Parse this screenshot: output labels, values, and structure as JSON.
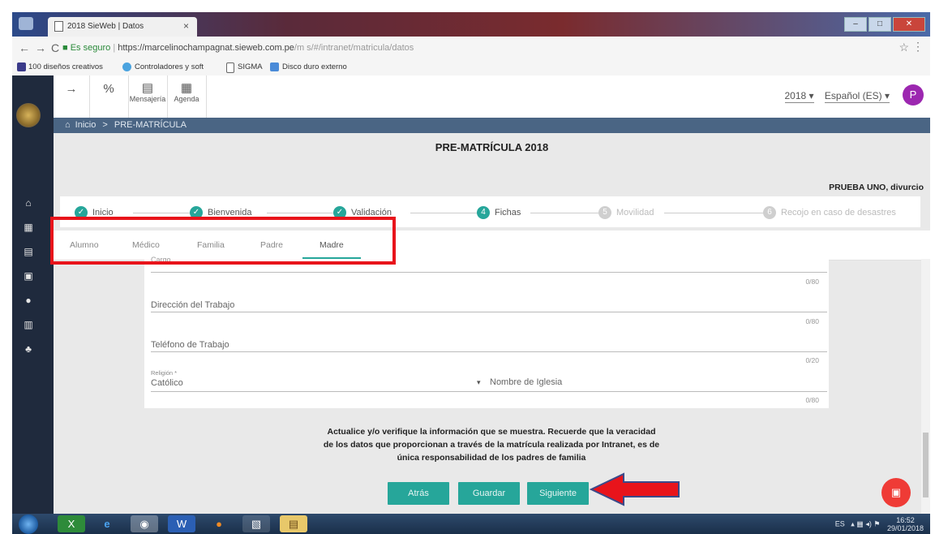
{
  "browser": {
    "tab_title": "2018 SieWeb | Datos",
    "tab_close": "×",
    "secure_label": "Es seguro",
    "url_host": "https://marcelinochampagnat.sieweb.com.pe",
    "url_path": "/m s/#/intranet/matricula/datos",
    "bookmarks": [
      "100 diseños creativos",
      "Controladores y soft",
      "SIGMA",
      "Disco duro externo"
    ]
  },
  "toolbar": {
    "mensajeria_label": "Mensajería",
    "agenda_label": "Agenda",
    "year": "2018",
    "language": "Español (ES)",
    "avatar_letter": "P"
  },
  "breadcrumb": {
    "home": "Inicio",
    "separator": ">",
    "current": "PRE-MATRÍCULA"
  },
  "page": {
    "title": "PRE-MATRÍCULA 2018",
    "user": "PRUEBA UNO, divurcio"
  },
  "steps": [
    {
      "label": "Inicio",
      "mark": "✓",
      "state": "done"
    },
    {
      "label": "Bienvenida",
      "mark": "✓",
      "state": "done"
    },
    {
      "label": "Validación",
      "mark": "✓",
      "state": "done"
    },
    {
      "label": "Fichas",
      "mark": "4",
      "state": "current"
    },
    {
      "label": "Movilidad",
      "mark": "5",
      "state": "pending"
    },
    {
      "label": "Recojo en caso de desastres",
      "mark": "6",
      "state": "pending"
    }
  ],
  "tabs": [
    "Alumno",
    "Médico",
    "Familia",
    "Padre",
    "Madre"
  ],
  "form": {
    "cargo_label": "Cargo",
    "cargo_count": "0/80",
    "direccion_label": "Dirección del Trabajo",
    "direccion_count": "0/80",
    "telefono_label": "Teléfono de Trabajo",
    "telefono_count": "0/20",
    "religion_label": "Religión *",
    "religion_value": "Católico",
    "iglesia_label": "Nombre de Iglesia",
    "iglesia_count": "0/80"
  },
  "notice": {
    "line1": "Actualice y/o verifique la información que se muestra. Recuerde que la veracidad",
    "line2": "de los datos que proporcionan a través de la matrícula realizada por Intranet, es de",
    "line3": "única responsabilidad de los padres de familia"
  },
  "buttons": {
    "back": "Atrás",
    "save": "Guardar",
    "next": "Siguiente"
  },
  "taskbar": {
    "lang": "ES",
    "time": "16:52",
    "date": "29/01/2018"
  },
  "colors": {
    "accent": "#26a69a",
    "sidebar": "#1f2a3d",
    "breadcrumb": "#4a6584",
    "annotation": "#e8141b",
    "fab": "#ef3b36",
    "avatar": "#9c27b0"
  }
}
